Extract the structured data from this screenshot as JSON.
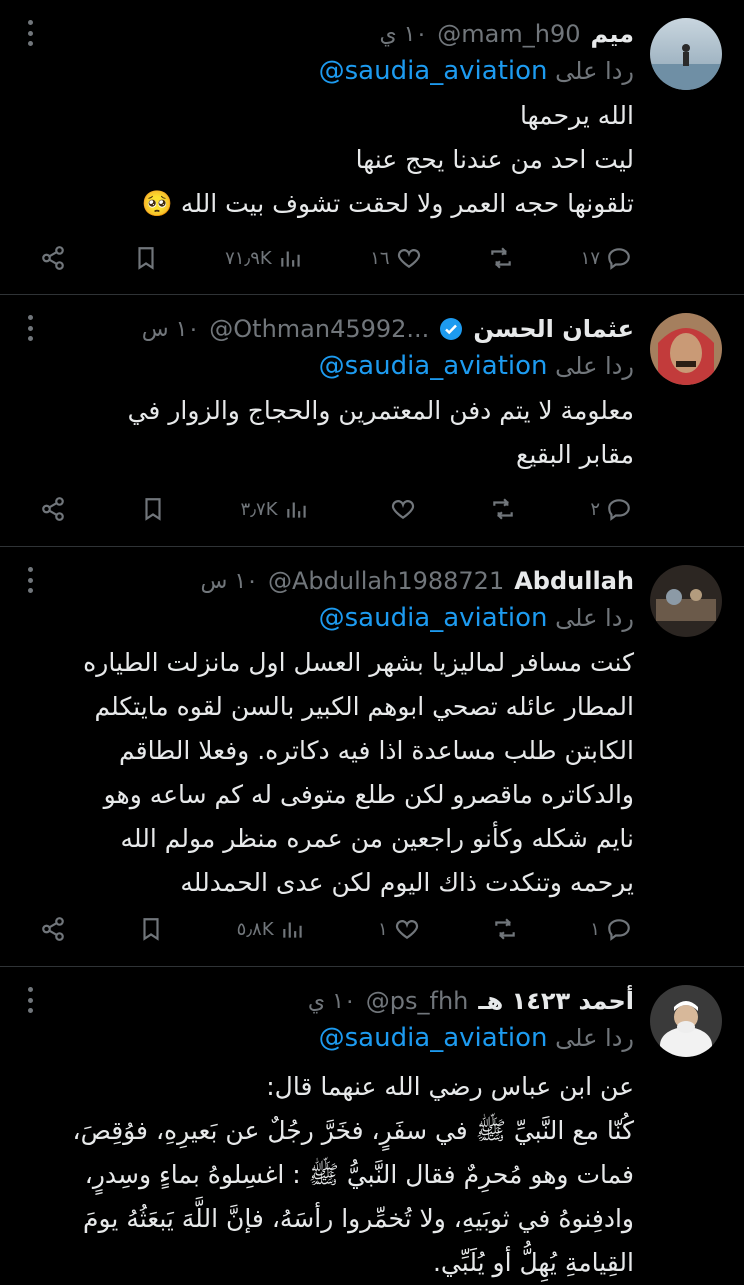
{
  "tweets": [
    {
      "name": "ميم",
      "handle": "@mam_h90",
      "time": "١٠ ي",
      "reply_prefix": "ردا على",
      "reply_to": "@saudia_aviation",
      "lines": [
        "الله يرحمها",
        "ليت احد من عندنا يحج عنها",
        "تلقونها حجه العمر ولا لحقت تشوف بيت الله 🥺"
      ],
      "replies": "١٧",
      "retweets": "",
      "likes": "١٦",
      "views": "٧١٫٩K"
    },
    {
      "name": "عثمان الحسن",
      "handle": "@Othman45992...",
      "time": "١٠ س",
      "reply_prefix": "ردا على",
      "reply_to": "@saudia_aviation",
      "lines": [
        "معلومة لا يتم دفن المعتمرين والحجاج والزوار في",
        "مقابر البقيع"
      ],
      "replies": "٢",
      "retweets": "",
      "likes": "",
      "views": "٣٫٧K"
    },
    {
      "name": "Abdullah",
      "handle": "@Abdullah1988721",
      "time": "١٠ س",
      "reply_prefix": "ردا على",
      "reply_to": "@saudia_aviation",
      "lines": [
        "كنت مسافر لماليزيا بشهر العسل اول مانزلت الطياره",
        "المطار عائله تصحي ابوهم الكبير بالسن لقوه مايتكلم",
        "الكابتن طلب مساعدة اذا فيه دكاتره. وفعلا الطاقم",
        "والدكاتره ماقصرو لكن طلع متوفى له كم ساعه وهو",
        "نايم شكله وكأنو راجعين من عمره منظر مولم الله",
        "يرحمه وتنكدت ذاك اليوم لكن عدى الحمدلله"
      ],
      "replies": "١",
      "retweets": "",
      "likes": "١",
      "views": "٥٫٨K"
    },
    {
      "name": "أحمد ١٤٢٣ هـ",
      "handle": "@ps_fhh",
      "time": "١٠ ي",
      "reply_prefix": "ردا على",
      "reply_to": "@saudia_aviation",
      "lines": [
        "عن ابن عباس رضي الله عنهما قال:",
        "كُنّا مع النَّبيِّ ﷺ في سفَرٍ، فخَرَّ رجُلٌ عن بَعيرِهِ، فوُقِصَ،",
        "فمات وهو مُحرِمٌ فقال النَّبيُّ ﷺ : اغسِلوهُ بماءٍ وسِدرٍ،",
        "وادفِنوهُ في ثوبَيهِ، ولا تُخمِّروا رأسَهُ، فإنَّ اللَّهَ يَبعَثُهُ يومَ",
        "القِيامةِ يُهِلُّ أو يُلَبِّي."
      ],
      "replies": "",
      "retweets": "",
      "likes": "",
      "views": ""
    }
  ],
  "icons": {
    "reply": "reply-icon",
    "retweet": "retweet-icon",
    "like": "heart-icon",
    "views": "views-icon",
    "bookmark": "bookmark-icon",
    "share": "share-icon",
    "more": "more-icon",
    "verified": "verified-badge-icon"
  },
  "colors": {
    "background": "#000000",
    "text": "#e7e9ea",
    "secondary": "#71767b",
    "link": "#1d9bf0",
    "divider": "#2f3336"
  }
}
